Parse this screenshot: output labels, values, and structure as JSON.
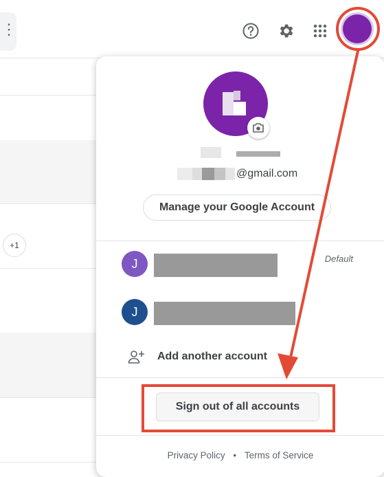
{
  "header": {
    "icons": {
      "help": "help-circle-icon",
      "settings": "gear-icon",
      "apps": "apps-grid-icon"
    },
    "avatar_color": "#7b23a9"
  },
  "background": {
    "chip_text": "+1"
  },
  "account_panel": {
    "primary_email_suffix": "@gmail.com",
    "manage_button_label": "Manage your Google Account",
    "accounts": [
      {
        "initial": "J",
        "avatar_color": "#7e57c2",
        "badge": "Default"
      },
      {
        "initial": "J",
        "avatar_color": "#1e4f8f"
      }
    ],
    "add_account_label": "Add another account",
    "sign_out_label": "Sign out of all accounts",
    "footer": {
      "privacy_label": "Privacy Policy",
      "separator": "•",
      "terms_label": "Terms of Service"
    }
  },
  "annotation_color": "#e34a36"
}
